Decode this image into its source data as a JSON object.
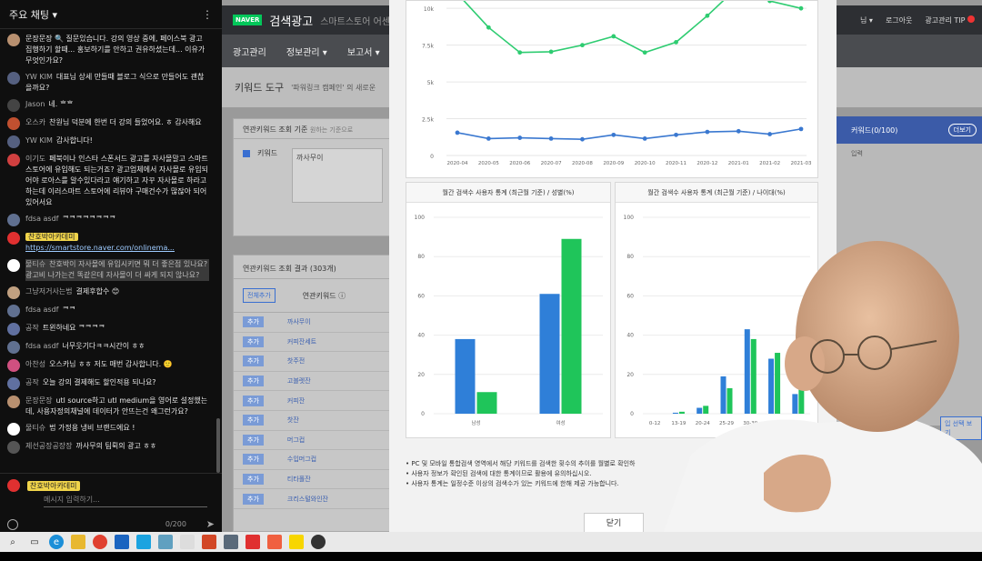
{
  "chat": {
    "header_title": "주요 채팅",
    "messages": [
      {
        "author": "",
        "text": "문장문장 🔍 질문있습니다. 강의 영상 중에, 페이스북 광고 집행하기 할때... 홍보하기를 안하고 권유하셨는데... 이유가 무엇인가요?",
        "avatar": "#b89070"
      },
      {
        "author": "YW KIM",
        "text": "대표님 상세 만들때 블로그 식으로 만들어도 괜찮을까요?",
        "avatar": "#556080"
      },
      {
        "author": "Jason",
        "text": "네. ᄒᄒ",
        "avatar": "#444444"
      },
      {
        "author": "오스카",
        "text": "찬원님 덕분에 한번 더 강의 들었어요. ㅎ 감사해요",
        "avatar": "#c05030"
      },
      {
        "author": "YW KIM",
        "text": "감사합니다!",
        "avatar": "#556080"
      },
      {
        "author": "이기도",
        "text": "페북이나 인스타 스폰서드 광고를 자사몰말고 스마트스토어에 유입해도 되는거죠? 광고업체에서 자사몰로 유입되어야 로아스를 알수있다라고 얘기하고 자꾸 자사몰로 하라고 하는데 이러스마트 스토어에 리뷰야 구매건수가 많잖아 되어있어서요",
        "avatar": "#d04040"
      },
      {
        "author": "fdsa asdf",
        "text": "ᄏᄏᄏᄏᄏᄏᄏᄏ",
        "avatar": "#607090"
      },
      {
        "author": "찬호박아카데미",
        "badge": true,
        "text": "https://smartstore.naver.com/onlinema...",
        "link": true,
        "avatar": "#e03030"
      },
      {
        "author": "물티슈",
        "text": "찬호박이 자사몰에 유입시키면 뭐 더 좋은점 있나요? 광고비 나가는건 똑같은데 자사몰이 더 싸게 되지 않나요?",
        "hl": true,
        "avatar": "#ffffff"
      },
      {
        "author": "그냥저거사는법",
        "text": "결제후합수 😊",
        "avatar": "#c0a080"
      },
      {
        "author": "fdsa asdf",
        "text": "ᄏᄏ",
        "avatar": "#607090"
      },
      {
        "author": "공작",
        "text": "트윈하네요 ᄏᄏᄏᄏ",
        "avatar": "#6070a0"
      },
      {
        "author": "fdsa asdf",
        "text": "너무웃기다ㅋㅋ시간이 ㅎㅎ",
        "avatar": "#607090"
      },
      {
        "author": "아찬성",
        "text": "오스카님 ㅎㅎ 저도 매번 감사합니다. 🙂",
        "avatar": "#d05080"
      },
      {
        "author": "공작",
        "text": "오늘 강의 결제해도 할인적용 되나요?",
        "avatar": "#6070a0"
      },
      {
        "author": "문장문장",
        "text": "utl source하고 utl medium을 영어로 설정했는데, 사용자정의채널에 데이터가 안뜨는건 왜그런가요?",
        "avatar": "#b89070"
      },
      {
        "author": "물티슈",
        "text": "법 가정용 냉비 브랜드에요 !",
        "avatar": "#ffffff"
      },
      {
        "author": "제선공장공장장",
        "text": "까사무의 팀뤽의 광고 ㅎㅎ",
        "avatar": "#555555"
      }
    ],
    "input_author": "찬호박아카데미",
    "input_placeholder": "메시지 입력하기...",
    "char_count": "0/200"
  },
  "naver": {
    "logo_text": "NAVER",
    "brand": "검색광고",
    "sub_brand": "스마트스토어 어센",
    "top_right": [
      "님 ▾",
      "로그아웃",
      "광고관리 TIP"
    ],
    "nav": [
      "광고관리",
      "정보관리 ▾",
      "보고서 ▾"
    ],
    "tool_title": "키워드 도구",
    "tool_subtitle": "'파워링크 캠페인' 의 새로운",
    "panel1_header": "연관키워드 조회 기준",
    "panel1_header_sub": "원하는 기준으로",
    "panel1_label": "키워드",
    "panel1_value": "까사무이",
    "panel2_header": "연관키워드 조회 결과 (303개)",
    "add_all": "전체추가",
    "col_keyword": "연관키워드 ⓘ",
    "add_label": "추가",
    "keywords": [
      "까사무이",
      "커피잔세트",
      "찻주전",
      "고블렛잔",
      "커피잔",
      "찻잔",
      "머그컵",
      "수입머그컵",
      "티타폴잔",
      "크리스털와인잔"
    ],
    "right_header": "커워드(0/100)",
    "right_more": "더보기",
    "right_sub": "입력",
    "right_btn": "입 선택 보기"
  },
  "modal": {
    "line_chart": {
      "y_ticks": [
        "0",
        "2.5k",
        "5k",
        "7.5k",
        "10k"
      ]
    },
    "gender_title": "월간 검색수 사용자 통계 (최근월 기준) / 성별(%)",
    "age_title": "월간 검색수 사용자 통계 (최근월 기준) / 나이대(%)",
    "notes": [
      "PC 및 모바일 통합검색 영역에서 해당 키워드를 검색한 횟수의 추이를 월별로 확인하",
      "사용자 정보가 확인된 검색에 대한 통계이므로 활용에 유의하십시오.",
      "사용자 통계는 일정수준 이상의 검색수가 있는 키워드에 한해 제공 가능합니다."
    ],
    "close_label": "닫기"
  },
  "chart_data": [
    {
      "type": "line",
      "x": [
        "2020-04",
        "2020-05",
        "2020-06",
        "2020-07",
        "2020-08",
        "2020-09",
        "2020-10",
        "2020-11",
        "2020-12",
        "2021-01",
        "2021-02",
        "2021-03"
      ],
      "series": [
        {
          "name": "",
          "color": "#2ecc71",
          "values": [
            11000,
            8700,
            7000,
            7050,
            7500,
            8100,
            7000,
            7700,
            9500,
            11500,
            10500,
            10000
          ]
        },
        {
          "name": "",
          "color": "#3a78d0",
          "values": [
            1550,
            1150,
            1200,
            1150,
            1100,
            1400,
            1150,
            1400,
            1600,
            1650,
            1450,
            1800
          ]
        }
      ],
      "ylim": [
        0,
        11000
      ],
      "y_ticks": [
        0,
        2500,
        5000,
        7500,
        10000
      ],
      "grid": true
    },
    {
      "type": "bar",
      "categories": [
        "남성",
        "여성"
      ],
      "series": [
        {
          "name": "",
          "color": "#2f7fd8",
          "values": [
            38,
            61
          ]
        },
        {
          "name": "",
          "color": "#1fc55a",
          "values": [
            11,
            89
          ]
        }
      ],
      "ylim": [
        0,
        100
      ],
      "y_ticks": [
        0,
        20,
        40,
        60,
        80,
        100
      ],
      "grid": true
    },
    {
      "type": "bar",
      "categories": [
        "0-12",
        "13-19",
        "20-24",
        "25-29",
        "30-39",
        "40-49",
        "50-"
      ],
      "series": [
        {
          "name": "",
          "color": "#2f7fd8",
          "values": [
            0,
            0.5,
            3,
            19,
            43,
            28,
            10
          ]
        },
        {
          "name": "",
          "color": "#1fc55a",
          "values": [
            0,
            1,
            4,
            13,
            38,
            31,
            13
          ]
        }
      ],
      "ylim": [
        0,
        100
      ],
      "y_ticks": [
        0,
        20,
        40,
        60,
        80,
        100
      ],
      "grid": true
    }
  ]
}
